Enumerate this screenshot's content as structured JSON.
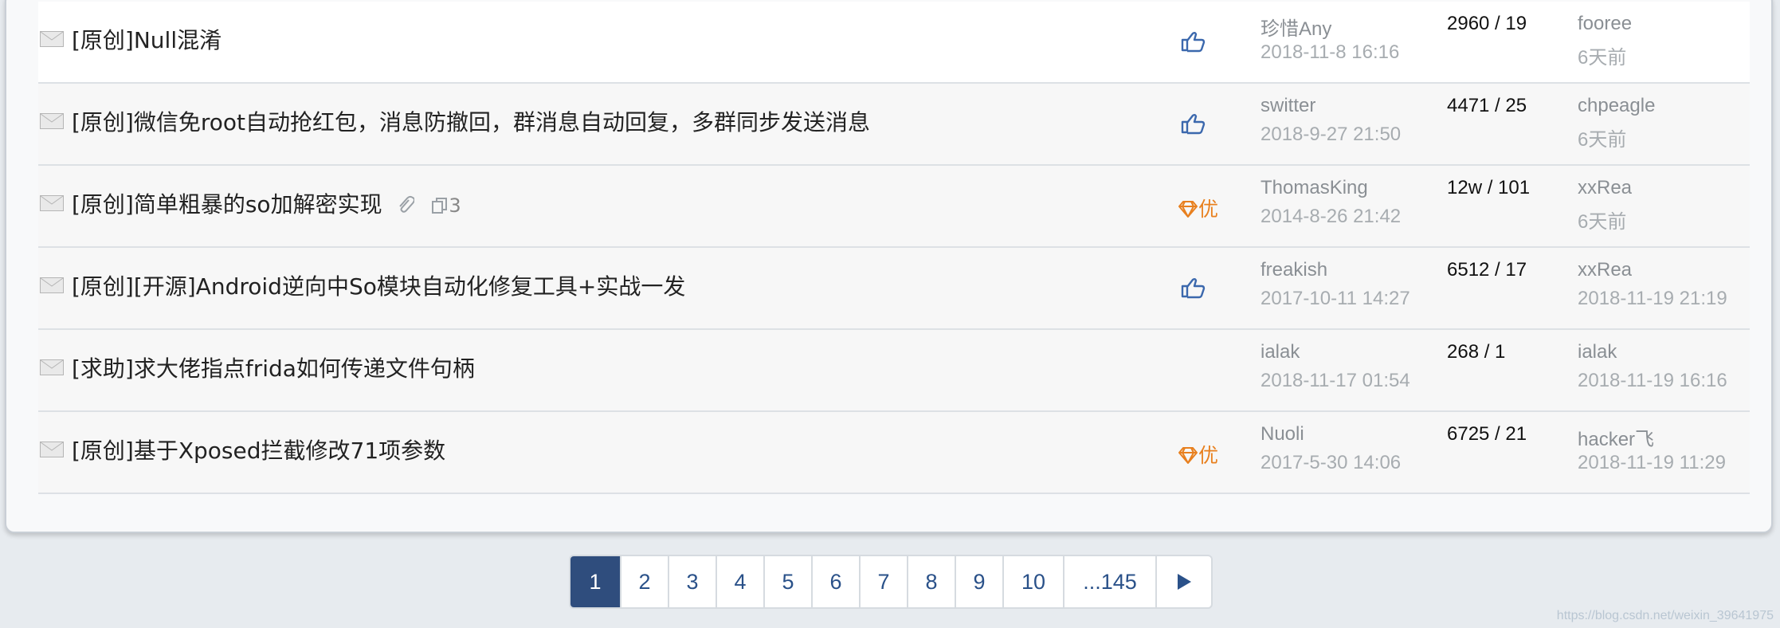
{
  "rows": [
    {
      "title": "[原创]Null混淆",
      "extra": "",
      "badge": "thumb",
      "author": "珍惜Any",
      "date": "2018-11-8 16:16",
      "stats": "2960 / 19",
      "last_user": "fooree",
      "last_time": "6天前"
    },
    {
      "title": "[原创]微信免root自动抢红包，消息防撤回，群消息自动回复，多群同步发送消息",
      "extra": "",
      "badge": "thumb",
      "author": "switter",
      "date": "2018-9-27 21:50",
      "stats": "4471 / 25",
      "last_user": "chpeagle",
      "last_time": "6天前"
    },
    {
      "title": "[原创]简单粗暴的so加解密实现",
      "extra": "3",
      "badge": "diamond",
      "badge_label": "优",
      "author": "ThomasKing",
      "date": "2014-8-26 21:42",
      "stats": "12w / 101",
      "last_user": "xxRea",
      "last_time": "6天前"
    },
    {
      "title": "[原创][开源]Android逆向中So模块自动化修复工具+实战一发",
      "extra": "",
      "badge": "thumb",
      "author": "freakish",
      "date": "2017-10-11 14:27",
      "stats": "6512 / 17",
      "last_user": "xxRea",
      "last_time": "2018-11-19 21:19"
    },
    {
      "title": "[求助]求大佬指点frida如何传递文件句柄",
      "extra": "",
      "badge": "",
      "author": "ialak",
      "date": "2018-11-17 01:54",
      "stats": "268 / 1",
      "last_user": "ialak",
      "last_time": "2018-11-19 16:16"
    },
    {
      "title": "[原创]基于Xposed拦截修改71项参数",
      "extra": "",
      "badge": "diamond",
      "badge_label": "优",
      "author": "Nuoli",
      "date": "2017-5-30 14:06",
      "stats": "6725 / 21",
      "last_user": "hacker飞",
      "last_time": "2018-11-19 11:29"
    }
  ],
  "pagination": {
    "pages": [
      "1",
      "2",
      "3",
      "4",
      "5",
      "6",
      "7",
      "8",
      "9",
      "10",
      "...145"
    ],
    "active": "1",
    "next_icon": "next-arrow-icon"
  },
  "watermark": "https://blog.csdn.net/weixin_39641975",
  "colors": {
    "accent": "#2f4d7d",
    "badge_orange": "#e8801f",
    "thumb_blue": "#3b68ad"
  }
}
